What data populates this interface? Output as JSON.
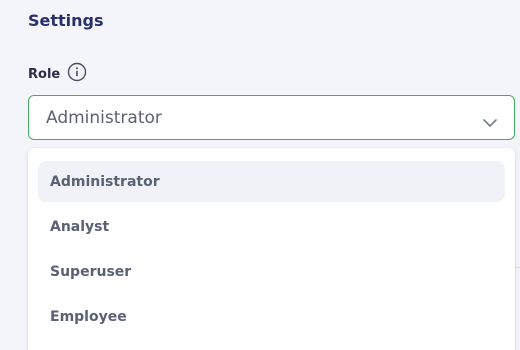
{
  "section": {
    "title": "Settings"
  },
  "role_field": {
    "label": "Role",
    "selected_value": "Administrator",
    "icons": {
      "info": "info-icon",
      "toggle": "chevron-down-icon"
    }
  },
  "dropdown": {
    "options": [
      {
        "label": "Administrator",
        "selected": true
      },
      {
        "label": "Analyst",
        "selected": false
      },
      {
        "label": "Superuser",
        "selected": false
      },
      {
        "label": "Employee",
        "selected": false
      }
    ]
  },
  "colors": {
    "title": "#2b2f6b",
    "focus_border": "#45ad63",
    "option_text": "#5b6175",
    "selected_option_bg": "#f1f2f7",
    "page_background": "#f4f5fa"
  }
}
